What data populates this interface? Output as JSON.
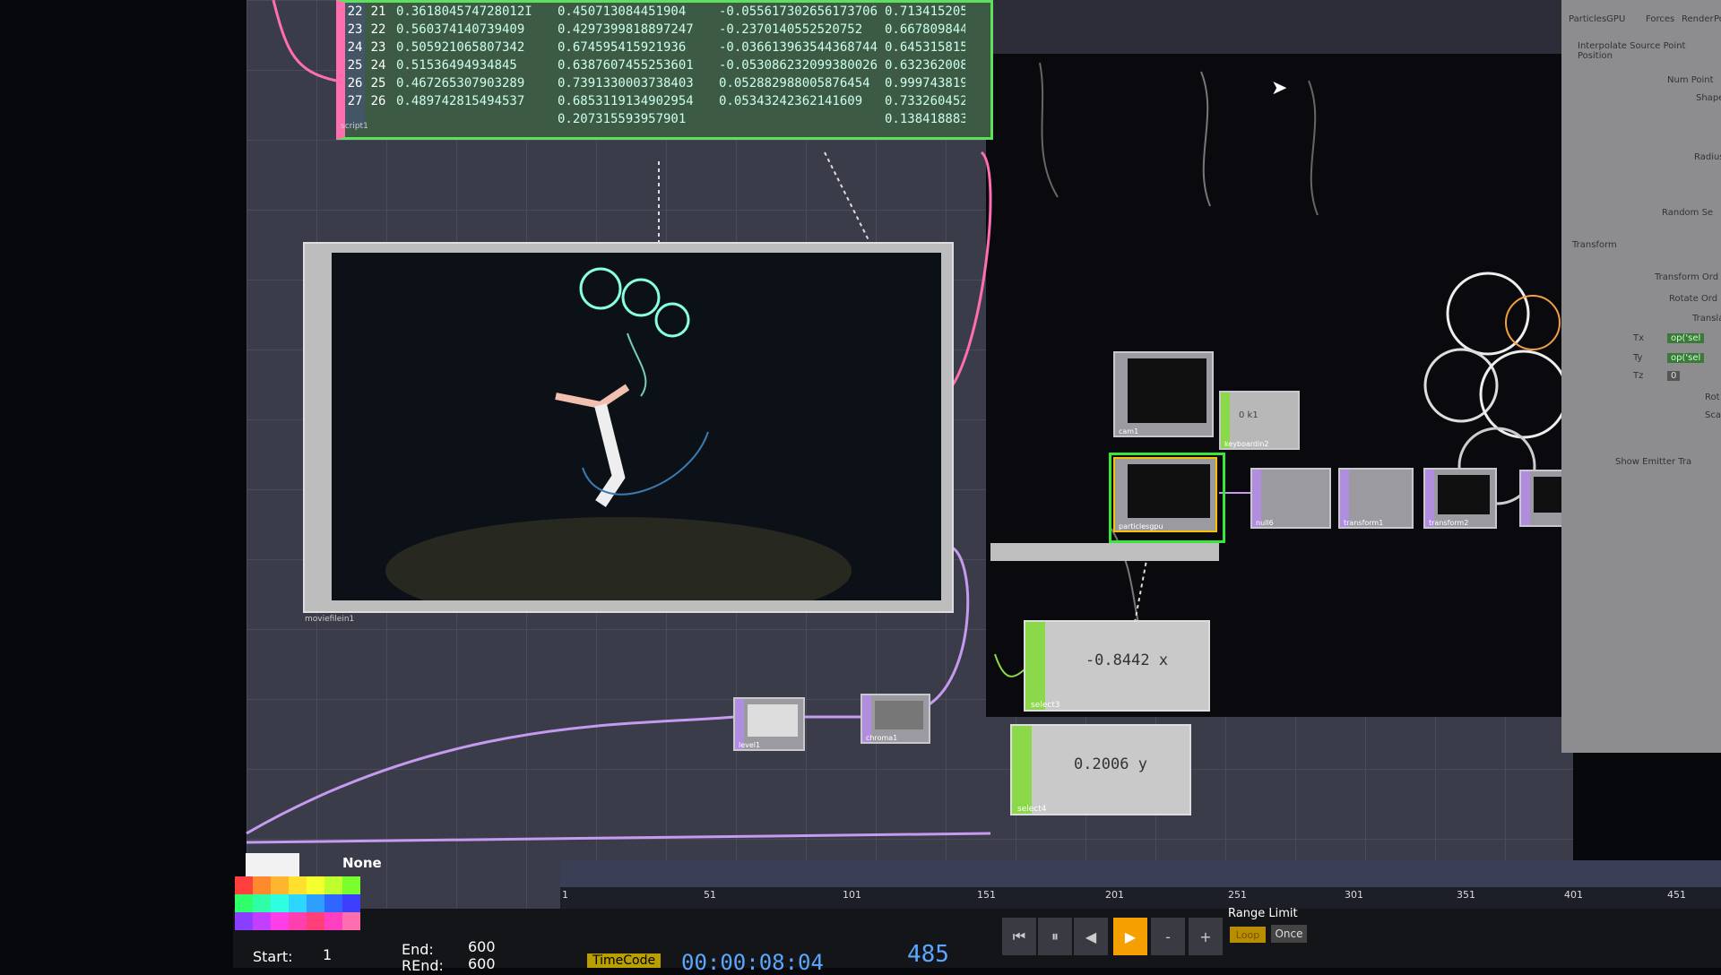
{
  "table": {
    "rows": [
      [
        "22",
        "21",
        "0.361804574728012I",
        "0.450713084451904",
        "-0.055617302656173706",
        "0.713415205"
      ],
      [
        "23",
        "22",
        "0.560374140739409",
        "0.4297399818897247",
        "-0.2370140552520752",
        "0.667809844"
      ],
      [
        "24",
        "23",
        "0.505921065807342",
        "0.674595415921936",
        "-0.036613963544368744",
        "0.645315815"
      ],
      [
        "25",
        "24",
        "0.51536494934845",
        "0.6387607455253601",
        "-0.053086232099380026",
        "0.632362008"
      ],
      [
        "26",
        "25",
        "0.467265307903289",
        "0.7391330003738403",
        "0.052882988005876454",
        "0.999743819"
      ],
      [
        "27",
        "26",
        "0.489742815494537",
        "0.6853119134902954",
        "0.05343242362141609",
        "0.733260452"
      ],
      [
        "",
        "",
        "",
        "0.207315593957901",
        "",
        "0.138418883"
      ]
    ],
    "label": "script1"
  },
  "viewer": {
    "label": "moviefilein1"
  },
  "nodes": {
    "cam1": "cam1",
    "keyboardin2": "keyboardin2",
    "keyboardin_value": "0 k1",
    "particlesgpu": "particlesgpu",
    "null6": "null6",
    "transform1": "transform1",
    "transform2": "transform2",
    "level1": "level1",
    "chroma1": "chroma1"
  },
  "select3": {
    "value": "-0.8442 x",
    "label": "select3"
  },
  "select4": {
    "value": "0.2006 y",
    "label": "select4"
  },
  "params": {
    "tabs": [
      "ParticlesGPU",
      "Forces",
      "Render",
      "Po"
    ],
    "header": "Interpolate Source Point Position",
    "labels": [
      "Num Point",
      "Shape",
      "Radius",
      "Random Se",
      "Transform",
      "Transform Ord",
      "Rotate Ord",
      "Translat",
      "Rot",
      "Sca",
      "Show Emitter Tra"
    ],
    "expr_tx": "op('sel",
    "expr_ty": "op('sel",
    "expr_tz": "0"
  },
  "ruler": {
    "ticks": [
      "1",
      "51",
      "101",
      "151",
      "201",
      "251",
      "301",
      "351",
      "401",
      "451"
    ]
  },
  "palette": {
    "none_label": "None"
  },
  "range": {
    "start_label": "Start:",
    "start_value": "1",
    "end_label": "End:",
    "end_value": "600",
    "rend_label": "REnd:",
    "rend_value": "600"
  },
  "transport": {
    "timecode_tag": "TimeCode",
    "timecode": "00:00:08:04",
    "frame": "485",
    "buttons": [
      "⏮",
      "⏸",
      "◀",
      "▶",
      "-",
      "+"
    ],
    "range_limit_label": "Range Limit",
    "loop_label": "Loop",
    "once_label": "Once"
  },
  "colors": {
    "accent_orange": "#f5a000",
    "selection_green": "#39e63a",
    "wire_pink": "#ff6fb0",
    "wire_purple": "#c59af0"
  }
}
